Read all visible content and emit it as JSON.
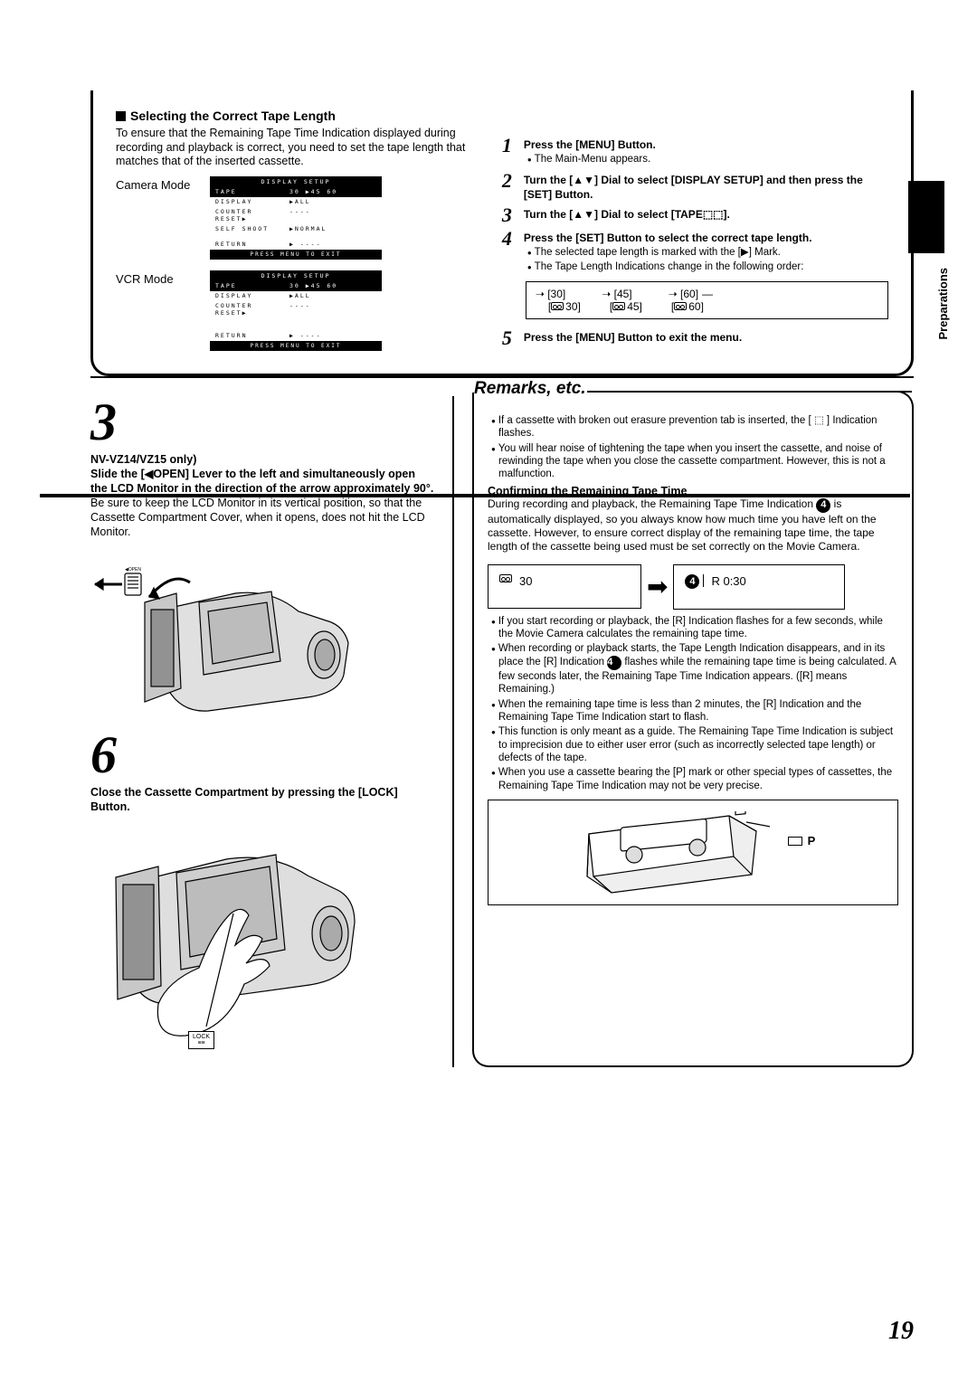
{
  "page_number": "19",
  "side_tab": "Preparations",
  "upper": {
    "heading": "Selecting the Correct Tape Length",
    "intro": "To ensure that the Remaining Tape Time Indication displayed during recording and playback is correct, you need to set the tape length that matches that of the inserted cassette.",
    "camera_mode": "Camera Mode",
    "vcr_mode": "VCR Mode",
    "menu": {
      "title": "DISPLAY SETUP",
      "tape_label": "TAPE",
      "tape_vals": "30  ▶45   60",
      "display_label": "DISPLAY",
      "display_val": "▶ALL",
      "counter_label": "COUNTER RESET▶",
      "counter_val": "----",
      "self_label": "SELF SHOOT",
      "self_val": "▶NORMAL",
      "return_label": "RETURN",
      "return_val": "▶ ----",
      "footer": "PRESS MENU TO EXIT"
    },
    "steps": {
      "s1": "Press the [MENU] Button.",
      "s1_sub": "The Main-Menu appears.",
      "s2": "Turn the [▲▼] Dial  to select [DISPLAY SETUP] and then press the [SET] Button.",
      "s3": "Turn the [▲▼] Dial to select [TAPE⬚⬚].",
      "s4": "Press the [SET] Button to select the correct tape length.",
      "s4_sub1": "The selected tape length is marked with the [▶] Mark.",
      "s4_sub2": "The Tape Length Indications change in the following order:",
      "order_row1": {
        "a": "[30]",
        "b": "[45]",
        "c": "[60]"
      },
      "order_row2": {
        "a": "30]",
        "b": "45]",
        "c": "60]"
      },
      "s5": "Press the [MENU] Button to exit the menu."
    }
  },
  "lower": {
    "step3_model": "NV-VZ14/VZ15 only)",
    "step3_bold": "Slide the [◀OPEN] Lever to the left and simultaneously open the LCD Monitor in the direction of the arrow approximately 90°.",
    "step3_text": "Be sure to keep the LCD Monitor in its vertical position, so that the Cassette Compartment Cover, when it opens, does not hit the LCD Monitor.",
    "step6_bold": "Close the Cassette Compartment by pressing the [LOCK] Button.",
    "lock_label": "LOCK",
    "remarks_title": "Remarks, etc.",
    "r1": "If a cassette with broken out erasure prevention tab is inserted, the [ ⬚ ] Indication flashes.",
    "r2": "You will hear noise of tightening the tape when you insert the cassette, and noise of rewinding the tape when you close the cassette compartment. However, this is not a malfunction.",
    "confirm_heading": "Confirming the Remaining Tape Time",
    "confirm_para": "During recording and playback, the Remaining Tape Time Indication 4 is automatically displayed, so you always know how much time you have left on the cassette. However, to ensure correct display of the remaining tape time, the tape length of the cassette being used must be set correctly on the Movie Camera.",
    "disp_left": "30",
    "disp_right": "R  0:30",
    "b1": "If you start recording or playback, the [R] Indication flashes for a few seconds, while the Movie Camera calculates the remaining tape time.",
    "b2": "When recording or playback starts, the Tape Length Indication disappears, and in its place the [R] Indication 4 flashes while the remaining tape time is being calculated. A few seconds later, the Remaining Tape Time Indication appears. ([R] means Remaining.)",
    "b3": "When the remaining tape time is less than 2 minutes, the [R] Indication and the Remaining Tape Time Indication start to flash.",
    "b4": "This function is only meant as a guide. The Remaining Tape Time Indication is subject to imprecision due to either user error (such as incorrectly selected tape length) or defects of the tape.",
    "b5": "When you use a cassette bearing the [P] mark or other special types of cassettes, the Remaining Tape Time Indication may not be very precise.",
    "p_mark": "P"
  }
}
